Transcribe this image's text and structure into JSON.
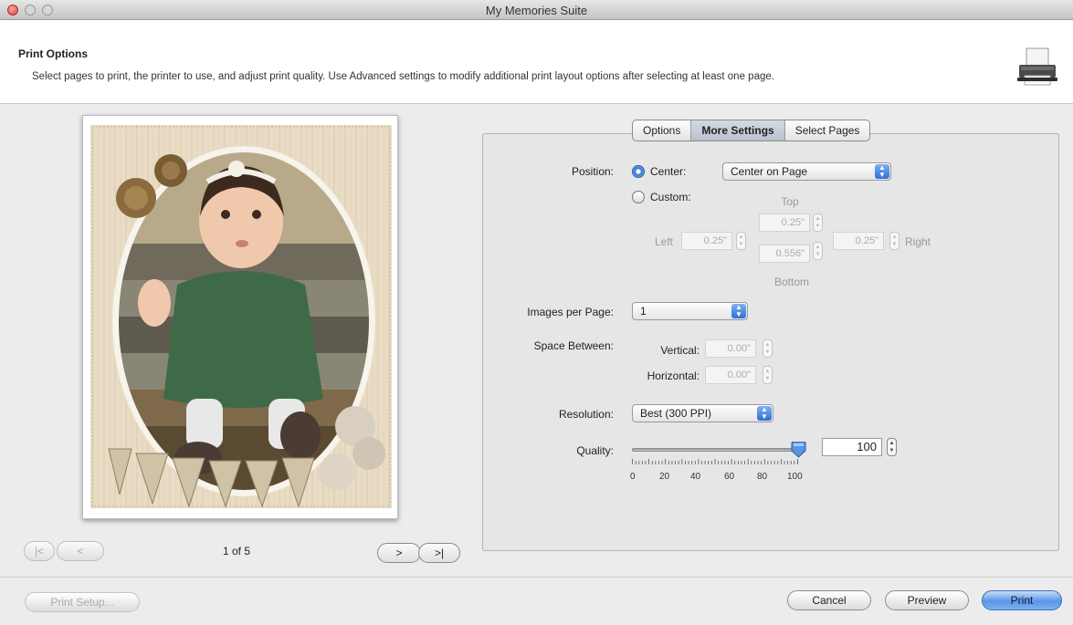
{
  "window": {
    "title": "My Memories Suite"
  },
  "header": {
    "title": "Print Options",
    "description": "Select pages to print, the printer to use, and adjust print quality. Use Advanced settings to modify additional print layout options after selecting at least one page."
  },
  "preview": {
    "page_count": "1 of 5",
    "nav": {
      "first": "|<",
      "prev": "<",
      "next": ">",
      "last": ">|"
    }
  },
  "tabs": [
    "Options",
    "More Settings",
    "Select Pages"
  ],
  "selected_tab": "More Settings",
  "position": {
    "label": "Position:",
    "center_label": "Center:",
    "center_option": "Center on Page",
    "custom_label": "Custom:",
    "top_label": "Top",
    "left_label": "Left",
    "right_label": "Right",
    "bottom_label": "Bottom",
    "top_value": "0.25\"",
    "left_value": "0.25\"",
    "right_value": "0.25\"",
    "bottom_value": "0.556\"",
    "selected": "center"
  },
  "images_per_page": {
    "label": "Images per Page:",
    "value": "1"
  },
  "space_between": {
    "label": "Space Between:",
    "vertical_label": "Vertical:",
    "vertical_value": "0.00\"",
    "horizontal_label": "Horizontal:",
    "horizontal_value": "0.00\""
  },
  "resolution": {
    "label": "Resolution:",
    "value": "Best (300 PPI)"
  },
  "quality": {
    "label": "Quality:",
    "value": "100",
    "slider_fraction": 1.0,
    "tick_labels": [
      "0",
      "20",
      "40",
      "60",
      "80",
      "100"
    ]
  },
  "buttons": {
    "print_setup": "Print Setup...",
    "cancel": "Cancel",
    "preview": "Preview",
    "print": "Print"
  },
  "colors": {
    "accent": "#2f6fd6",
    "default_button": "#5a96e6"
  }
}
